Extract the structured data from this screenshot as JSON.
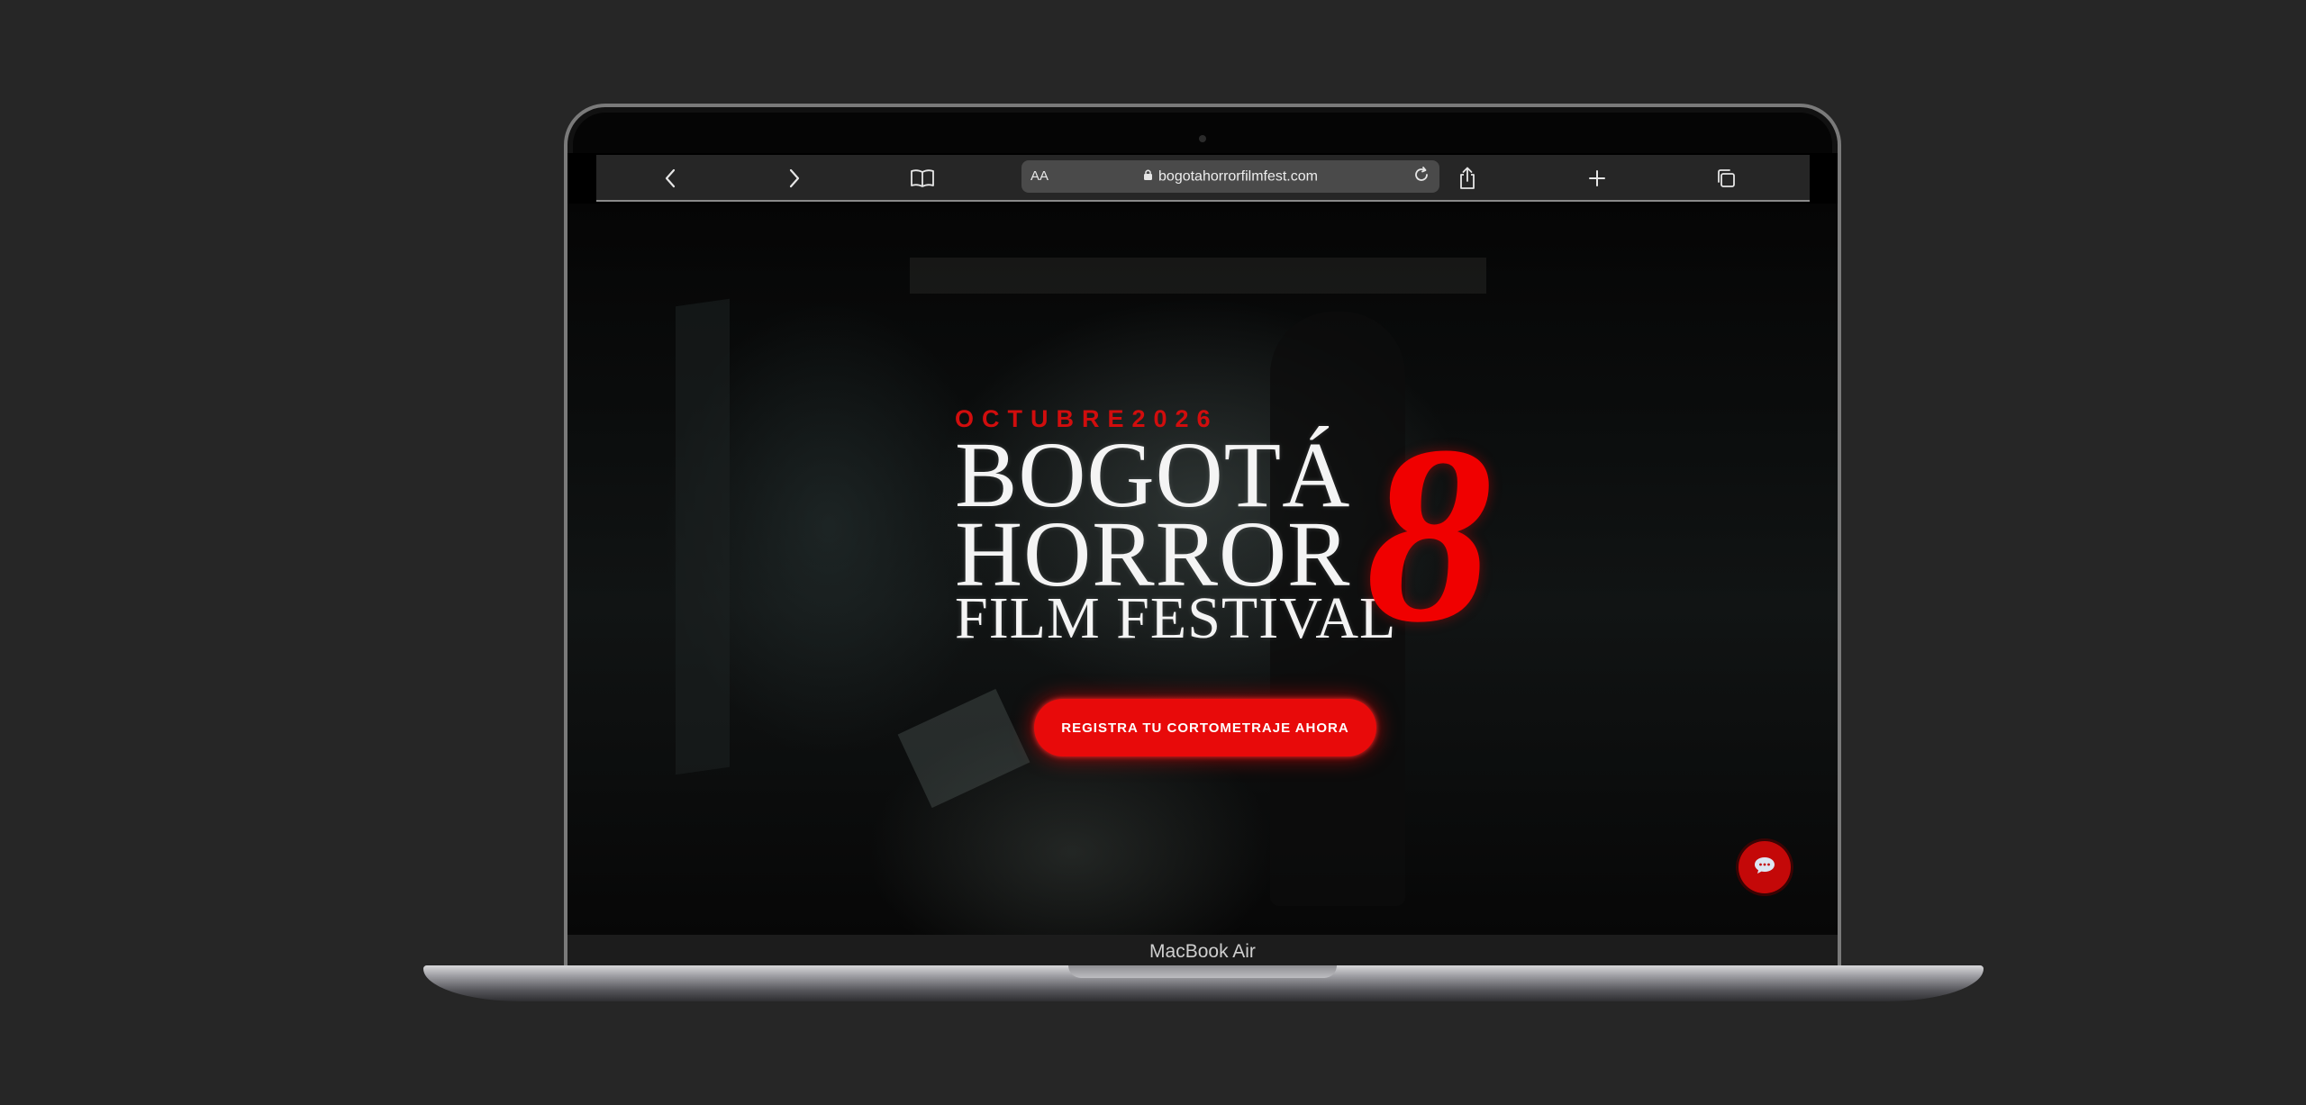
{
  "browser": {
    "text_size_label": "AA",
    "url": "bogotahorrorfilmfest.com",
    "icons": [
      "chevron-left-icon",
      "chevron-right-icon",
      "book-icon",
      "lock-icon",
      "reload-icon",
      "share-icon",
      "plus-icon",
      "tabs-icon"
    ]
  },
  "hero": {
    "date_label": "OCTUBRE2026",
    "title_line_1": "BOGOTÁ",
    "title_line_2": "HORROR",
    "title_line_3": "FILM FESTIVAL",
    "edition_number": "8",
    "cta_label": "REGISTRA TU CORTOMETRAJE AHORA",
    "chat_icon": "chat-bubble-icon"
  },
  "device": {
    "model_label": "MacBook Air"
  },
  "colors": {
    "accent_red": "#e80a0a",
    "date_red": "#d10d0d",
    "background": "#262626"
  }
}
